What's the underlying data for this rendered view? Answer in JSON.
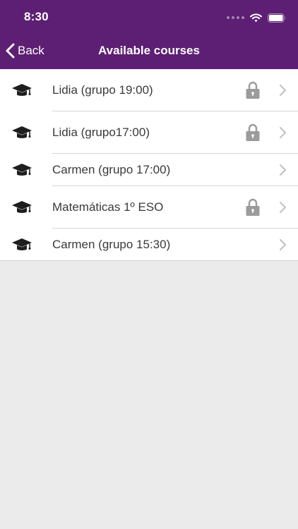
{
  "status_bar": {
    "time": "8:30"
  },
  "nav": {
    "back_label": "Back",
    "title": "Available courses"
  },
  "courses": [
    {
      "name": "Lidia (grupo 19:00)",
      "locked": true
    },
    {
      "name": "Lidia (grupo17:00)",
      "locked": true
    },
    {
      "name": "Carmen (grupo 17:00)",
      "locked": false
    },
    {
      "name": "Matemáticas 1º ESO",
      "locked": true
    },
    {
      "name": "Carmen (grupo 15:30)",
      "locked": false
    }
  ],
  "colors": {
    "header": "#5d1f73",
    "background": "#ebebeb",
    "text": "#3a3a3a",
    "lock": "#9b9b9b",
    "chevron": "#c0c0c0"
  },
  "icons": {
    "course": "graduation-cap-icon",
    "locked": "lock-icon",
    "disclosure": "chevron-right-icon",
    "back": "chevron-left-icon"
  }
}
